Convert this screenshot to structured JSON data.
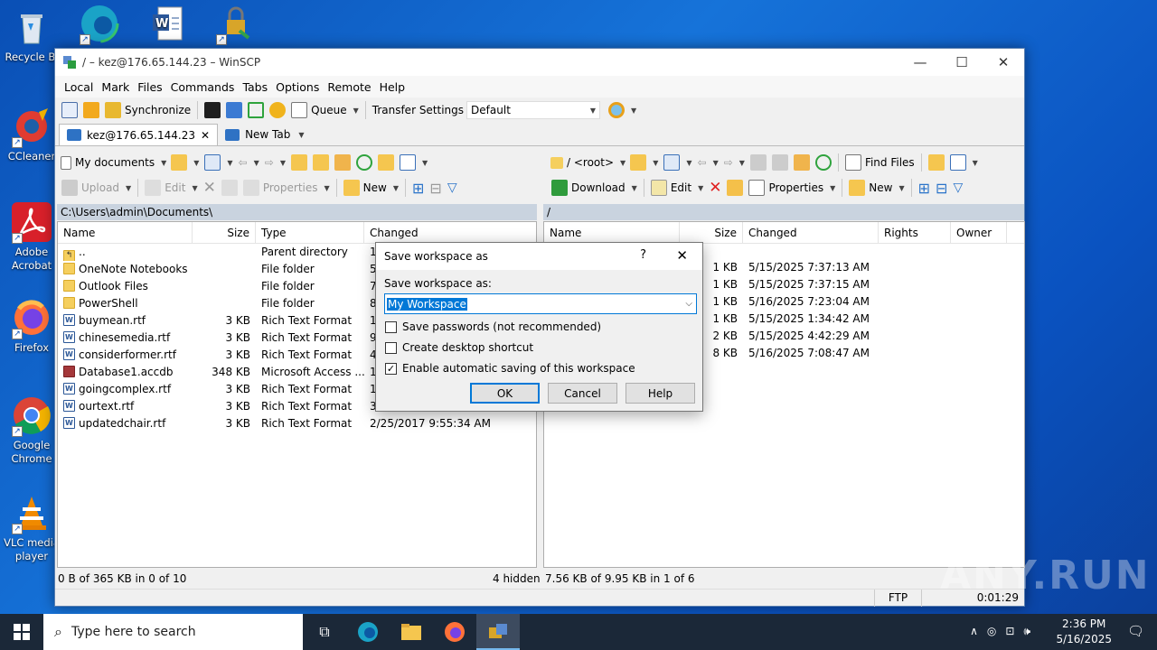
{
  "desktop": {
    "icons": [
      {
        "label": "Recycle Bin",
        "label_shown": "Recycle Bi"
      },
      {
        "label": "CCleaner",
        "label_shown": "CCleaner"
      },
      {
        "label": "Adobe Acrobat",
        "label_shown": "Adobe Acrobat"
      },
      {
        "label": "Firefox",
        "label_shown": "Firefox"
      },
      {
        "label": "Google Chrome",
        "label_shown": "Google Chrome"
      },
      {
        "label": "VLC media player",
        "label_shown": "VLC media player"
      }
    ]
  },
  "window": {
    "title": "/ – kez@176.65.144.23 – WinSCP",
    "minimize": "—",
    "maximize": "☐",
    "close": "✕"
  },
  "menu": [
    "Local",
    "Mark",
    "Files",
    "Commands",
    "Tabs",
    "Options",
    "Remote",
    "Help"
  ],
  "toolbar": {
    "synchronize": "Synchronize",
    "queue": "Queue",
    "transfer_settings": "Transfer Settings",
    "transfer_value": "Default"
  },
  "tabs": {
    "session": "kez@176.65.144.23",
    "new_tab": "New Tab"
  },
  "left": {
    "location": "My documents",
    "actions": {
      "upload": "Upload",
      "edit": "Edit",
      "properties": "Properties",
      "new": "New"
    },
    "path": "C:\\Users\\admin\\Documents\\",
    "columns": [
      "Name",
      "Size",
      "Type",
      "Changed"
    ],
    "rows": [
      {
        "icon": "up",
        "name": "..",
        "size": "",
        "type": "Parent directory",
        "changed": "1/"
      },
      {
        "icon": "folder",
        "name": "OneNote Notebooks",
        "size": "",
        "type": "File folder",
        "changed": "5/"
      },
      {
        "icon": "folder",
        "name": "Outlook Files",
        "size": "",
        "type": "File folder",
        "changed": "7/"
      },
      {
        "icon": "folder",
        "name": "PowerShell",
        "size": "",
        "type": "File folder",
        "changed": "8/"
      },
      {
        "icon": "rtf",
        "name": "buymean.rtf",
        "size": "3 KB",
        "type": "Rich Text Format",
        "changed": "1/"
      },
      {
        "icon": "rtf",
        "name": "chinesemedia.rtf",
        "size": "3 KB",
        "type": "Rich Text Format",
        "changed": "9/"
      },
      {
        "icon": "rtf",
        "name": "considerformer.rtf",
        "size": "3 KB",
        "type": "Rich Text Format",
        "changed": "4/"
      },
      {
        "icon": "acc",
        "name": "Database1.accdb",
        "size": "348 KB",
        "type": "Microsoft Access ...",
        "changed": "1/"
      },
      {
        "icon": "rtf",
        "name": "goingcomplex.rtf",
        "size": "3 KB",
        "type": "Rich Text Format",
        "changed": "1/"
      },
      {
        "icon": "rtf",
        "name": "ourtext.rtf",
        "size": "3 KB",
        "type": "Rich Text Format",
        "changed": "3/"
      },
      {
        "icon": "rtf",
        "name": "updatedchair.rtf",
        "size": "3 KB",
        "type": "Rich Text Format",
        "changed": "2/25/2017 9:55:34 AM"
      }
    ],
    "status": "0 B of 365 KB in 0 of 10",
    "hidden": "4 hidden"
  },
  "right": {
    "location": "/ <root>",
    "find_files": "Find Files",
    "actions": {
      "download": "Download",
      "edit": "Edit",
      "properties": "Properties",
      "new": "New"
    },
    "path": "/",
    "columns": [
      "Name",
      "Size",
      "Changed",
      "Rights",
      "Owner"
    ],
    "rows": [
      {
        "size": "1 KB",
        "changed": "5/15/2025 7:37:13 AM"
      },
      {
        "size": "1 KB",
        "changed": "5/15/2025 7:37:15 AM"
      },
      {
        "size": "1 KB",
        "changed": "5/16/2025 7:23:04 AM"
      },
      {
        "size": "1 KB",
        "changed": "5/15/2025 1:34:42 AM"
      },
      {
        "size": "2 KB",
        "changed": "5/15/2025 4:42:29 AM"
      },
      {
        "size": "8 KB",
        "changed": "5/16/2025 7:08:47 AM"
      }
    ],
    "status": "7.56 KB of 9.95 KB in 1 of 6"
  },
  "statusbar": {
    "protocol": "FTP",
    "time": "0:01:29"
  },
  "dialog": {
    "title": "Save workspace as",
    "help_glyph": "?",
    "close": "✕",
    "label": "Save workspace as:",
    "value": "My Workspace",
    "options": [
      {
        "label": "Save passwords (not recommended)",
        "checked": false
      },
      {
        "label": "Create desktop shortcut",
        "checked": false
      },
      {
        "label": "Enable automatic saving of this workspace",
        "checked": true
      }
    ],
    "ok": "OK",
    "cancel": "Cancel",
    "help": "Help"
  },
  "taskbar": {
    "search_placeholder": "Type here to search",
    "time": "2:36 PM",
    "date": "5/16/2025"
  },
  "watermark": "ANY.RUN",
  "colors": {
    "desktop": "#0a5fc8",
    "taskbar": "#1b2838",
    "pathbar": "#c9d3df",
    "selection": "#0078d7"
  }
}
